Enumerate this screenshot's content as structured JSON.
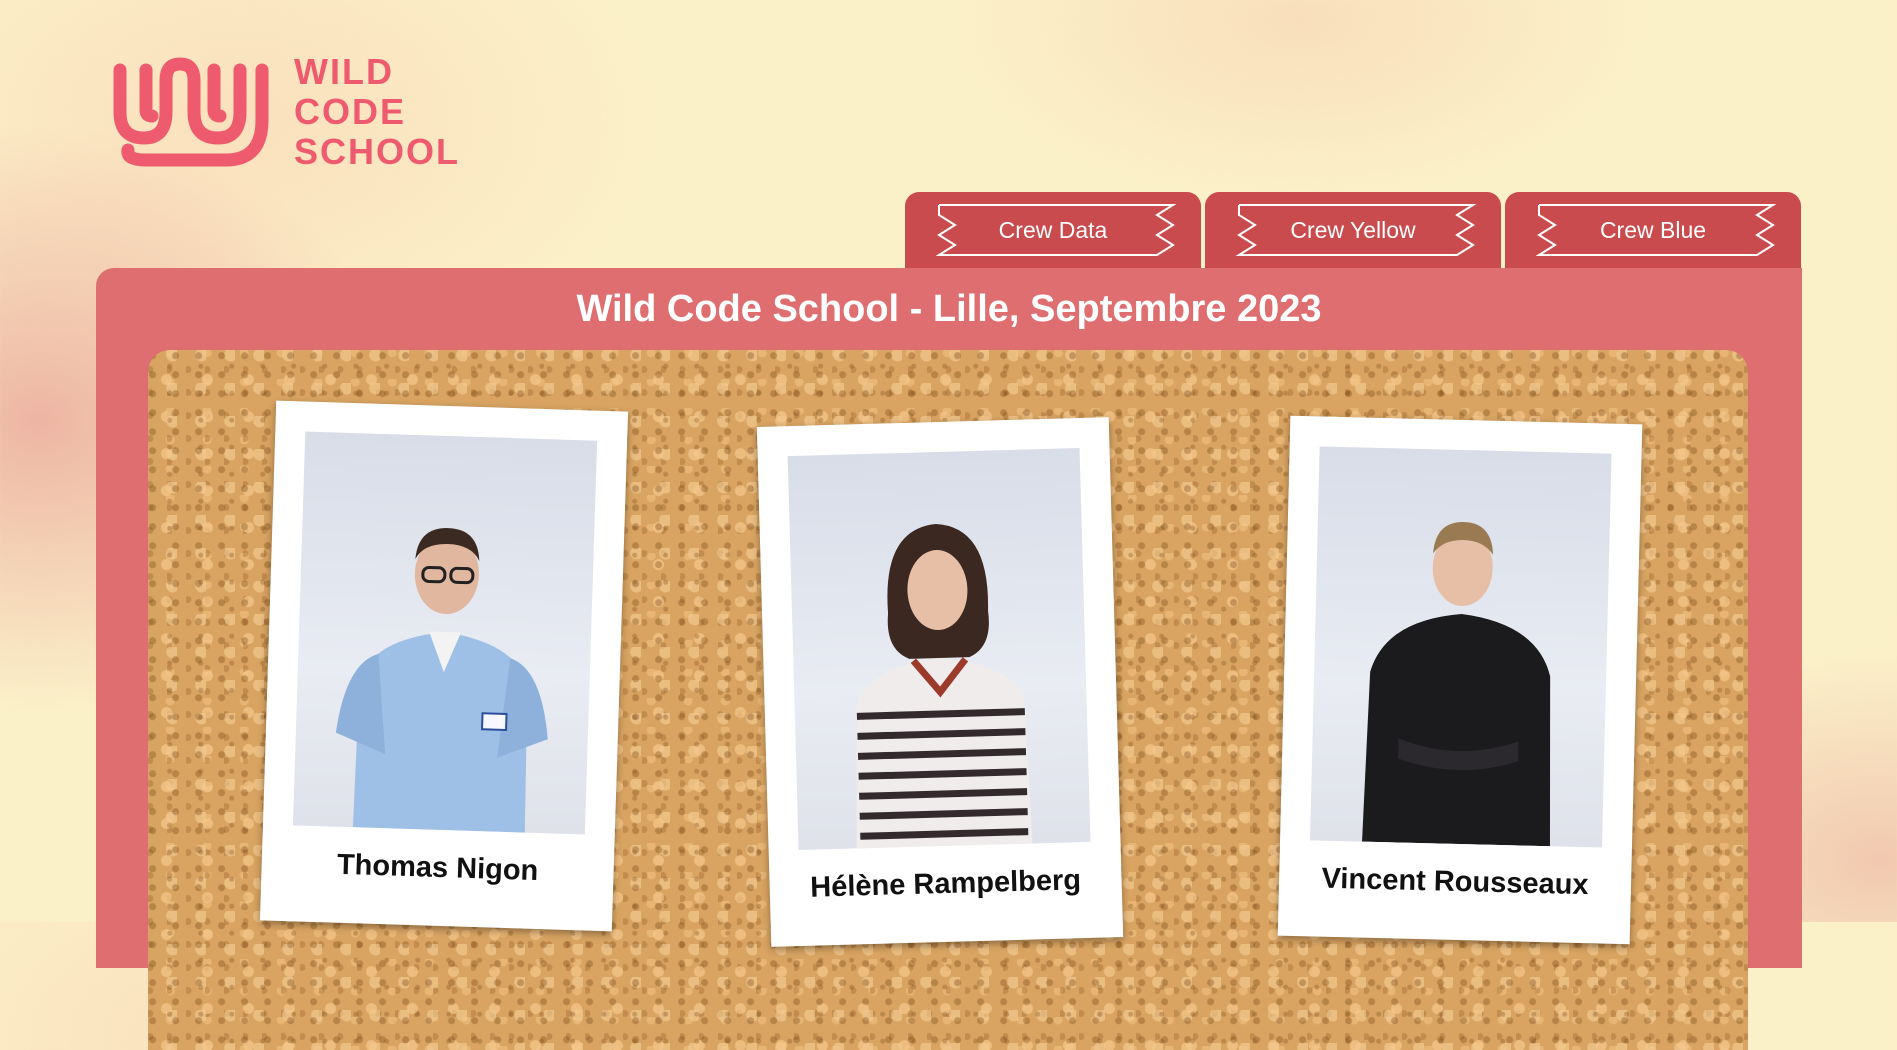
{
  "logo": {
    "icon": "wild-code-school-logo",
    "lines": [
      "WILD",
      "CODE",
      "SCHOOL"
    ],
    "color": "#ef5b6e"
  },
  "tabs": [
    {
      "label": "Crew Data"
    },
    {
      "label": "Crew Yellow"
    },
    {
      "label": "Crew Blue"
    }
  ],
  "colors": {
    "tab": "#c94b4d",
    "panel": "#de6e6f",
    "cork": "#d9a462",
    "background": "#fbf1c9"
  },
  "panel": {
    "title": "Wild Code School - Lille, Septembre 2023"
  },
  "cards": [
    {
      "name": "Thomas Nigon",
      "shirt": "#9fc0e6"
    },
    {
      "name": "Hélène Rampelberg",
      "shirt": "#3a2e33"
    },
    {
      "name": "Vincent Rousseaux",
      "shirt": "#1b1a1d"
    }
  ]
}
